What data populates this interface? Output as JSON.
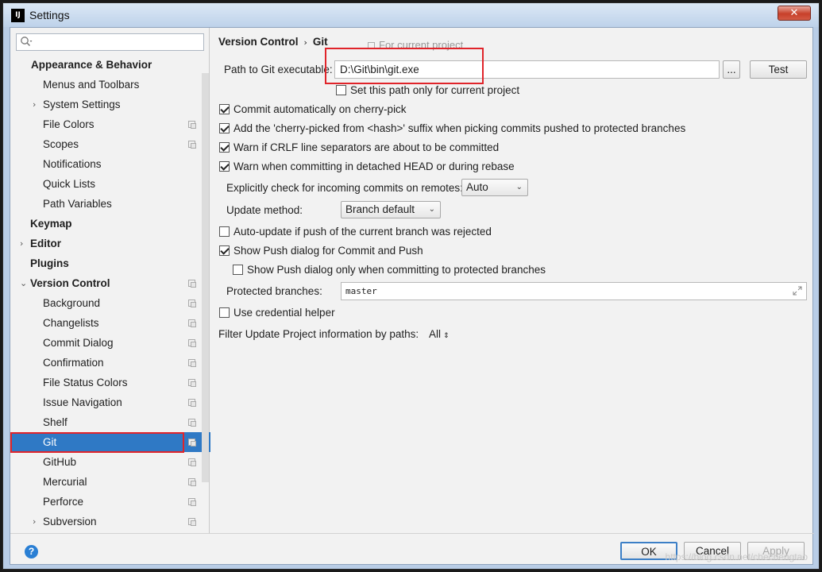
{
  "window": {
    "title": "Settings",
    "icon_text": "IJ",
    "close_glyph": "✕"
  },
  "sidebar": {
    "items": [
      {
        "label": "Appearance & Behavior",
        "level": 0,
        "bold": true,
        "arrow": "",
        "proj": false
      },
      {
        "label": "Menus and Toolbars",
        "level": 1,
        "bold": false,
        "arrow": "",
        "proj": false
      },
      {
        "label": "System Settings",
        "level": 1,
        "bold": false,
        "arrow": "›",
        "proj": false
      },
      {
        "label": "File Colors",
        "level": 1,
        "bold": false,
        "arrow": "",
        "proj": true
      },
      {
        "label": "Scopes",
        "level": 1,
        "bold": false,
        "arrow": "",
        "proj": true
      },
      {
        "label": "Notifications",
        "level": 1,
        "bold": false,
        "arrow": "",
        "proj": false
      },
      {
        "label": "Quick Lists",
        "level": 1,
        "bold": false,
        "arrow": "",
        "proj": false
      },
      {
        "label": "Path Variables",
        "level": 1,
        "bold": false,
        "arrow": "",
        "proj": false
      },
      {
        "label": "Keymap",
        "level": 0,
        "bold": true,
        "arrow": "",
        "proj": false
      },
      {
        "label": "Editor",
        "level": 0,
        "bold": true,
        "arrow": "›",
        "proj": false
      },
      {
        "label": "Plugins",
        "level": 0,
        "bold": true,
        "arrow": "",
        "proj": false
      },
      {
        "label": "Version Control",
        "level": 0,
        "bold": true,
        "arrow": "⌄",
        "proj": true
      },
      {
        "label": "Background",
        "level": 1,
        "bold": false,
        "arrow": "",
        "proj": true
      },
      {
        "label": "Changelists",
        "level": 1,
        "bold": false,
        "arrow": "",
        "proj": true
      },
      {
        "label": "Commit Dialog",
        "level": 1,
        "bold": false,
        "arrow": "",
        "proj": true
      },
      {
        "label": "Confirmation",
        "level": 1,
        "bold": false,
        "arrow": "",
        "proj": true
      },
      {
        "label": "File Status Colors",
        "level": 1,
        "bold": false,
        "arrow": "",
        "proj": true
      },
      {
        "label": "Issue Navigation",
        "level": 1,
        "bold": false,
        "arrow": "",
        "proj": true
      },
      {
        "label": "Shelf",
        "level": 1,
        "bold": false,
        "arrow": "",
        "proj": true
      },
      {
        "label": "Git",
        "level": 1,
        "bold": false,
        "arrow": "",
        "proj": true,
        "selected": true
      },
      {
        "label": "GitHub",
        "level": 1,
        "bold": false,
        "arrow": "",
        "proj": true
      },
      {
        "label": "Mercurial",
        "level": 1,
        "bold": false,
        "arrow": "",
        "proj": true
      },
      {
        "label": "Perforce",
        "level": 1,
        "bold": false,
        "arrow": "",
        "proj": true
      },
      {
        "label": "Subversion",
        "level": 1,
        "bold": false,
        "arrow": "›",
        "proj": true
      }
    ]
  },
  "main": {
    "breadcrumb": {
      "parent": "Version Control",
      "separator": "›",
      "current": "Git"
    },
    "for_current_project": "For current project",
    "path_label": "Path to Git executable:",
    "path_value": "D:\\Git\\bin\\git.exe",
    "browse_label": "...",
    "test_label": "Test",
    "set_path_only": {
      "label": "Set this path only for current project",
      "checked": false
    },
    "checkboxes": [
      {
        "label": "Commit automatically on cherry-pick",
        "checked": true
      },
      {
        "label": "Add the 'cherry-picked from <hash>' suffix when picking commits pushed to protected branches",
        "checked": true
      },
      {
        "label": "Warn if CRLF line separators are about to be committed",
        "checked": true
      },
      {
        "label": "Warn when committing in detached HEAD or during rebase",
        "checked": true
      }
    ],
    "incoming_label": "Explicitly check for incoming commits on remotes:",
    "incoming_value": "Auto",
    "update_method_label": "Update method:",
    "update_method_value": "Branch default",
    "auto_update": {
      "label": "Auto-update if push of the current branch was rejected",
      "checked": false
    },
    "show_push": {
      "label": "Show Push dialog for Commit and Push",
      "checked": true
    },
    "show_push_protected": {
      "label": "Show Push dialog only when committing to protected branches",
      "checked": false
    },
    "protected_label": "Protected branches:",
    "protected_value": "master",
    "credential_helper": {
      "label": "Use credential helper",
      "checked": false
    },
    "filter_label": "Filter Update Project information by paths:",
    "filter_value": "All"
  },
  "footer": {
    "help_glyph": "?",
    "ok_label": "OK",
    "cancel_label": "Cancel",
    "apply_label": "Apply",
    "watermark": "https://blog.csdn.net/chechengtao"
  }
}
